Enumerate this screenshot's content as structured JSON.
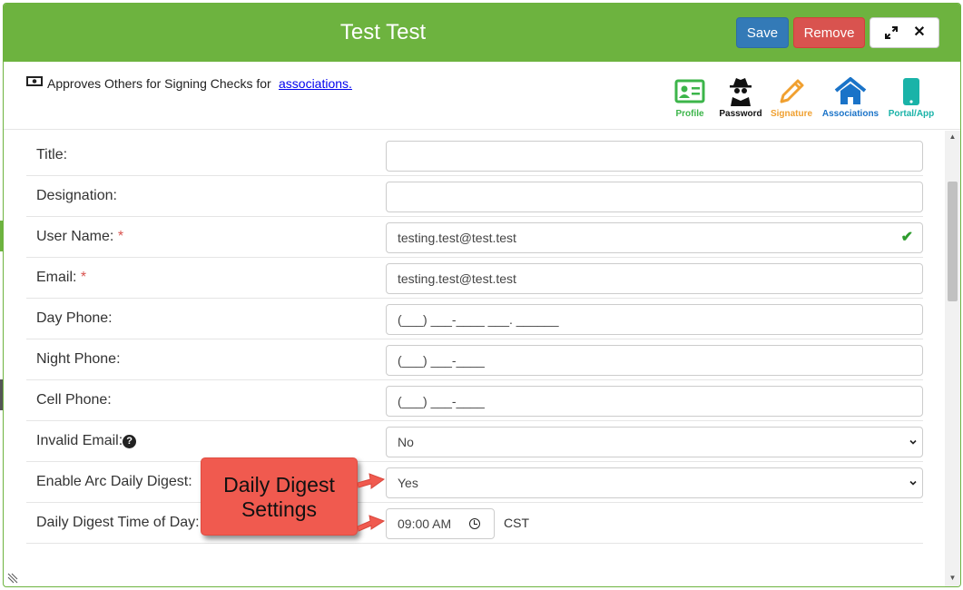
{
  "header": {
    "title": "Test Test",
    "save_label": "Save",
    "remove_label": "Remove",
    "expand_icon": "expand-icon",
    "close_icon": "close-icon"
  },
  "subheader": {
    "prefix_text": "Approves Others for Signing Checks for",
    "link_text": "associations."
  },
  "nav_icons": [
    {
      "label": "Profile",
      "icon": "profile-card-icon",
      "color": "#3cb54a"
    },
    {
      "label": "Password",
      "icon": "spy-icon",
      "color": "#111111"
    },
    {
      "label": "Signature",
      "icon": "pencil-icon",
      "color": "#f0a030"
    },
    {
      "label": "Associations",
      "icon": "house-icon",
      "color": "#1a73c8"
    },
    {
      "label": "Portal/App",
      "icon": "mobile-icon",
      "color": "#1ab3a8"
    }
  ],
  "form": {
    "title": {
      "label": "Title:",
      "value": ""
    },
    "designation": {
      "label": "Designation:",
      "value": ""
    },
    "user_name": {
      "label": "User Name:",
      "required": "*",
      "value": "testing.test@test.test"
    },
    "email": {
      "label": "Email:",
      "required": "*",
      "value": "testing.test@test.test"
    },
    "day_phone": {
      "label": "Day Phone:",
      "placeholder": "(___) ___-____ ___. ______"
    },
    "night_phone": {
      "label": "Night Phone:",
      "placeholder": "(___) ___-____"
    },
    "cell_phone": {
      "label": "Cell Phone:",
      "placeholder": "(___) ___-____"
    },
    "invalid_email": {
      "label": "Invalid Email:",
      "value": "No"
    },
    "arc_digest": {
      "label": "Enable Arc Daily Digest:",
      "value": "Yes"
    },
    "digest_time": {
      "label": "Daily Digest Time of Day:",
      "value": "09:00 AM",
      "timezone": "CST"
    }
  },
  "callout": {
    "text_line1": "Daily Digest",
    "text_line2": "Settings"
  },
  "colors": {
    "header_green": "#6db33f",
    "save_blue": "#337ab7",
    "remove_red": "#d9534f",
    "callout_red": "#f05a4f"
  }
}
